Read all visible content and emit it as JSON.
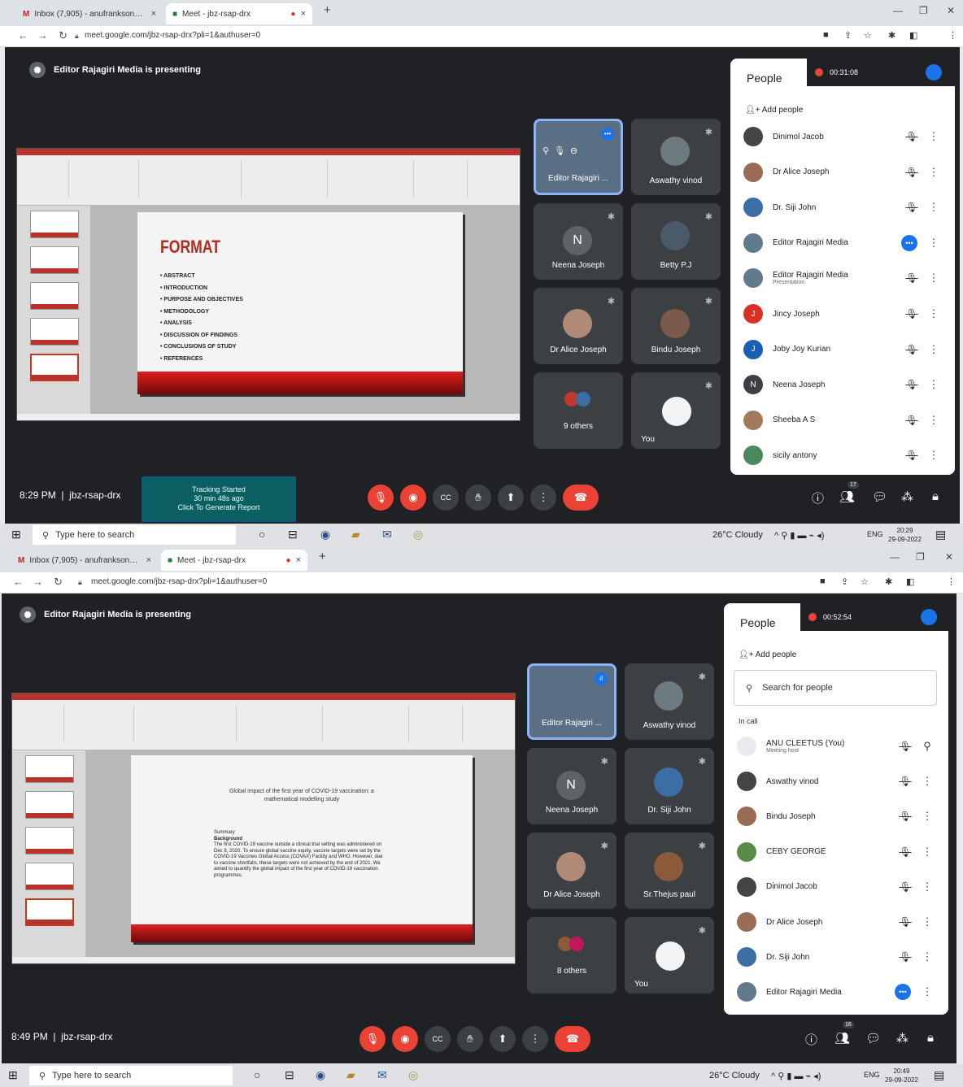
{
  "shots": [
    {
      "tabs": [
        {
          "label": "Inbox (7,905) - anufrankson@g",
          "close": "×"
        },
        {
          "label": "Meet - jbz-rsap-drx",
          "close": "×"
        }
      ],
      "new_tab": "+",
      "url": "meet.google.com/jbz-rsap-drx?pli=1&authuser=0",
      "presenting": "Editor Rajagiri Media is presenting",
      "slide": {
        "title": "FORMAT",
        "bullets": [
          "ABSTRACT",
          "INTRODUCTION",
          "PURPOSE AND OBJECTIVES",
          "METHODOLOGY",
          "ANALYSIS",
          "DISCUSSION OF FINDINGS",
          "CONCLUSIONS OF STUDY",
          "REFERENCES"
        ]
      },
      "tiles": [
        {
          "name": "Editor Rajagiri ...",
          "type": "editor"
        },
        {
          "name": "Aswathy vinod",
          "type": "photo"
        },
        {
          "name": "Neena Joseph",
          "initial": "N",
          "type": "initial"
        },
        {
          "name": "Betty P.J",
          "type": "photo"
        },
        {
          "name": "Dr Alice Joseph",
          "type": "photo"
        },
        {
          "name": "Bindu Joseph",
          "type": "photo"
        },
        {
          "name": "9 others",
          "type": "group"
        },
        {
          "name": "You",
          "type": "you"
        }
      ],
      "panel": {
        "title": "People",
        "timer": "00:31:08",
        "add_people": "Add people",
        "people": [
          {
            "name": "Dinimol Jacob",
            "sub": "",
            "color": "#444444"
          },
          {
            "name": "Dr Alice Joseph",
            "sub": "",
            "color": "#9a6b55"
          },
          {
            "name": "Dr. Siji John",
            "sub": "",
            "color": "#3b6ea5"
          },
          {
            "name": "Editor Rajagiri Media",
            "sub": "",
            "color": "#5f7b8c",
            "speaking": true
          },
          {
            "name": "Editor Rajagiri Media",
            "sub": "Presentation",
            "color": "#5f7b8c"
          },
          {
            "name": "Jincy Joseph",
            "sub": "",
            "initial": "J",
            "color": "#d93025"
          },
          {
            "name": "Joby Joy Kurian",
            "sub": "",
            "initial": "J",
            "color": "#1a5fb4"
          },
          {
            "name": "Neena Joseph",
            "sub": "",
            "initial": "N",
            "color": "#3c4043"
          },
          {
            "name": "Sheeba A S",
            "sub": "",
            "color": "#a07a5a"
          },
          {
            "name": "sicily antony",
            "sub": "",
            "color": "#4a8a5a"
          }
        ]
      },
      "time": "8:29 PM",
      "code": "jbz-rsap-drx",
      "tracking": {
        "line1": "Tracking Started",
        "line2": "30 min 48s ago",
        "line3": "Click To Generate Report"
      },
      "people_count": "17",
      "taskbar": {
        "search": "Type here to search",
        "weather": "26°C Cloudy",
        "lang": "ENG",
        "time": "20:29",
        "date": "29-09-2022"
      }
    },
    {
      "tabs": [
        {
          "label": "Inbox (7,905) - anufrankson@g",
          "close": "×"
        },
        {
          "label": "Meet - jbz-rsap-drx",
          "close": "×"
        }
      ],
      "new_tab": "+",
      "url": "meet.google.com/jbz-rsap-drx?pli=1&authuser=0",
      "presenting": "Editor Rajagiri Media is presenting",
      "slide": {
        "title": "Global impact of the first year of COVID-19 vaccination: a mathematical modelling study",
        "body_heading": "Summary",
        "body_sub": "Background",
        "body": "The first COVID-19 vaccine outside a clinical trial setting was administered on Dec 8, 2020. To ensure global vaccine equity, vaccine targets were set by the COVID-19 Vaccines Global Access (COVAX) Facility and WHO. However, due to vaccine shortfalls, these targets were not achieved by the end of 2021. We aimed to quantify the global impact of the first year of COVID-19 vaccination programmes."
      },
      "tiles": [
        {
          "name": "Editor Rajagiri ...",
          "type": "editor"
        },
        {
          "name": "Aswathy vinod",
          "type": "photo"
        },
        {
          "name": "Neena Joseph",
          "initial": "N",
          "type": "initial"
        },
        {
          "name": "Dr. Siji John",
          "type": "photo"
        },
        {
          "name": "Dr Alice Joseph",
          "type": "photo"
        },
        {
          "name": "Sr.Thejus paul",
          "type": "photo"
        },
        {
          "name": "8 others",
          "type": "group"
        },
        {
          "name": "You",
          "type": "you"
        }
      ],
      "panel": {
        "title": "People",
        "timer": "00:52:54",
        "add_people": "Add people",
        "search_placeholder": "Search for people",
        "in_call": "In call",
        "people": [
          {
            "name": "ANU CLEETUS (You)",
            "sub": "Meeting host",
            "color": "#e8eaed",
            "pin": true
          },
          {
            "name": "Aswathy vinod",
            "sub": "",
            "color": "#444444"
          },
          {
            "name": "Bindu Joseph",
            "sub": "",
            "color": "#9a6b55"
          },
          {
            "name": "CEBY GEORGE",
            "sub": "",
            "color": "#5a8a4a"
          },
          {
            "name": "Dinimol Jacob",
            "sub": "",
            "color": "#444444"
          },
          {
            "name": "Dr Alice Joseph",
            "sub": "",
            "color": "#9a6b55"
          },
          {
            "name": "Dr. Siji John",
            "sub": "",
            "color": "#3b6ea5"
          },
          {
            "name": "Editor Rajagiri Media",
            "sub": "",
            "color": "#5f7b8c",
            "speaking": true
          }
        ]
      },
      "time": "8:49 PM",
      "code": "jbz-rsap-drx",
      "people_count": "16",
      "taskbar": {
        "search": "Type here to search",
        "weather": "26°C Cloudy",
        "lang": "ENG",
        "time": "20:49",
        "date": "29-09-2022"
      }
    }
  ]
}
